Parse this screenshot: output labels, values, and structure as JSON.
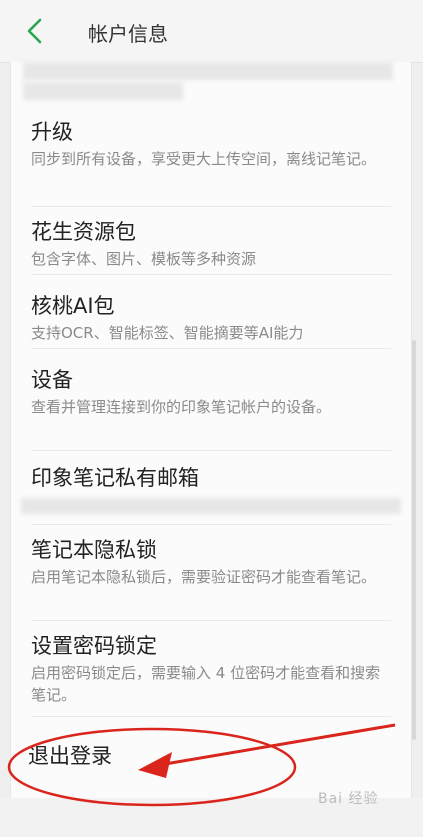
{
  "header": {
    "title": "帐户信息"
  },
  "items": [
    {
      "title": "升级",
      "desc": "同步到所有设备，享受更大上传空间，离线记笔记。"
    },
    {
      "title": "花生资源包",
      "desc": "包含字体、图片、模板等多种资源"
    },
    {
      "title": "核桃AI包",
      "desc": "支持OCR、智能标签、智能摘要等AI能力"
    },
    {
      "title": "设备",
      "desc": "查看并管理连接到你的印象笔记帐户的设备。"
    },
    {
      "title": "印象笔记私有邮箱",
      "desc": ""
    },
    {
      "title": "笔记本隐私锁",
      "desc": "启用笔记本隐私锁后，需要验证密码才能查看笔记。"
    },
    {
      "title": "设置密码锁定",
      "desc": "启用密码锁定后，需要输入 4 位密码才能查看和搜索笔记。"
    }
  ],
  "logout": {
    "label": "退出登录"
  },
  "watermark": {
    "text": "Bai 经验"
  },
  "icons": {
    "back": "chevron-left-icon",
    "back_color": "#27a64f",
    "annotation_color": "#d9251c"
  }
}
